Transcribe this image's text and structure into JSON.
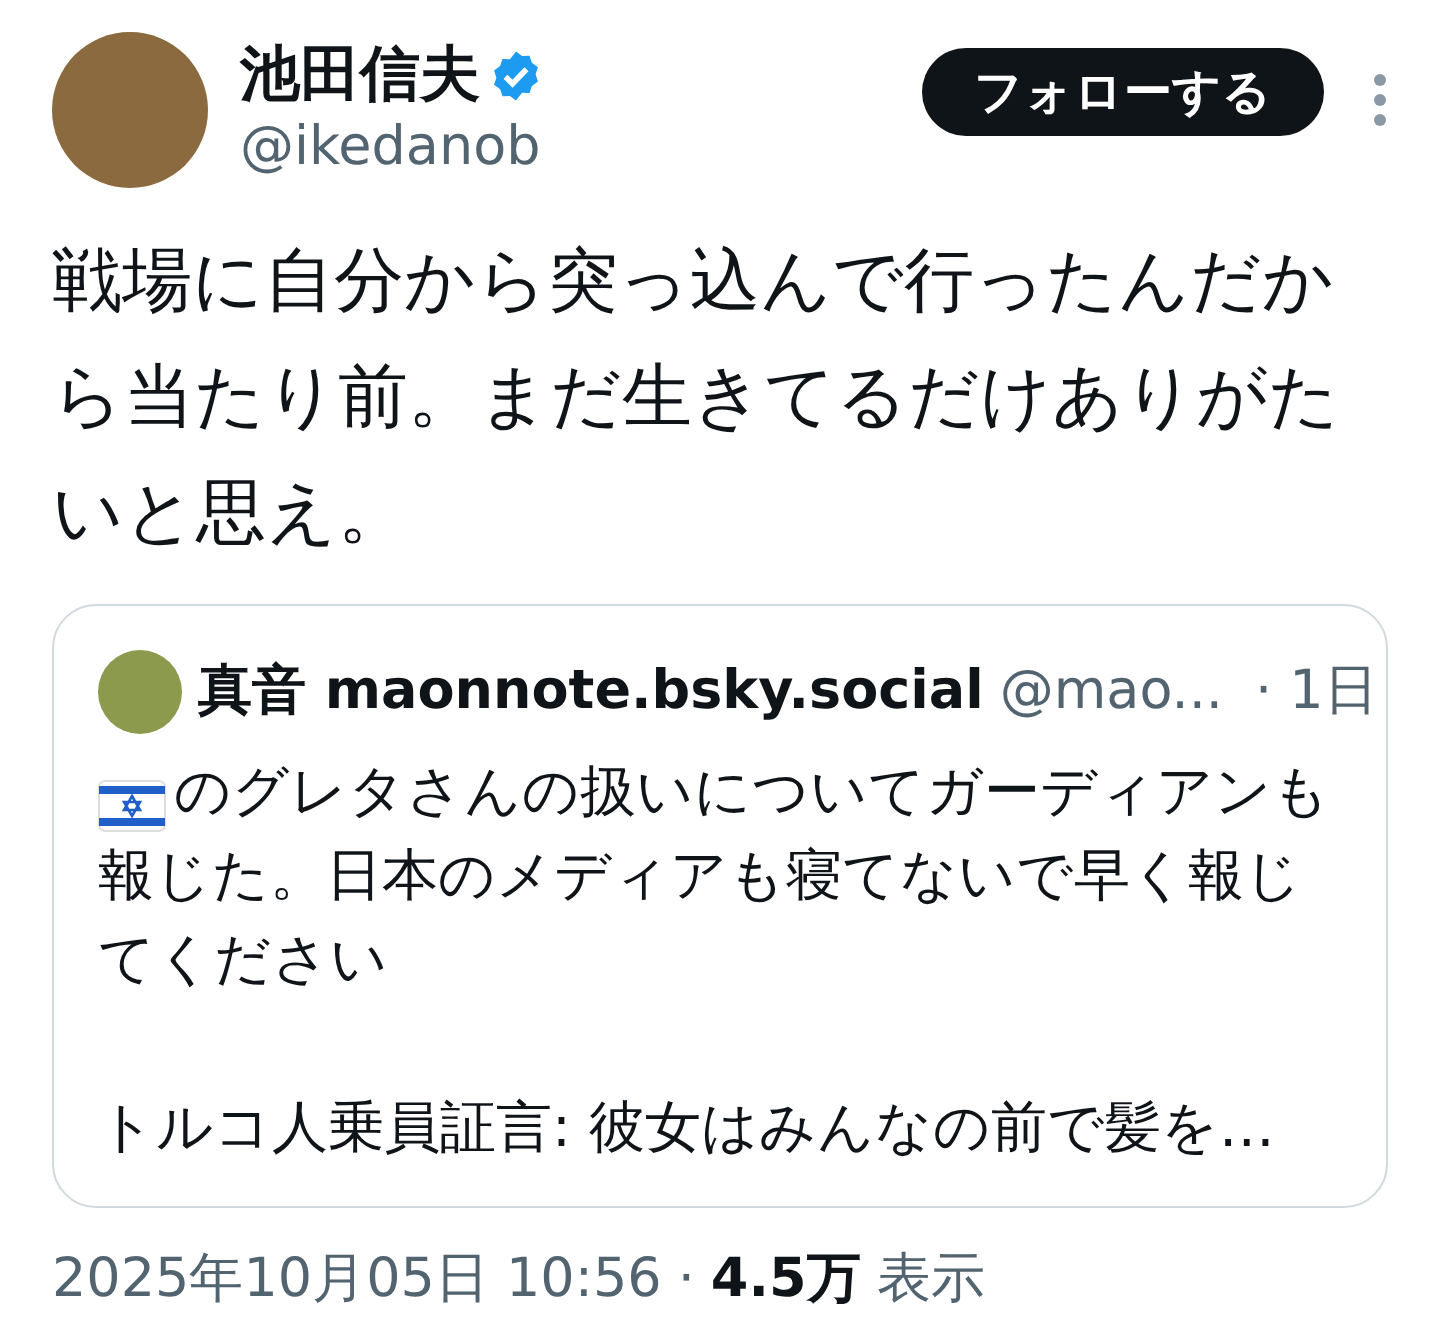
{
  "author": {
    "name": "池田信夫",
    "verified": true,
    "handle": "@ikedanob"
  },
  "follow_button": "フォローする",
  "text": "戦場に自分から突っ込んで行ったんだから当たり前。まだ生きてるだけありがたいと思え。",
  "quote": {
    "name": "真音 maonnote.bsky.social",
    "handle": "@mao...",
    "time": "· 1日",
    "paragraphs": [
      {
        "flag": true,
        "text": "のグレタさんの扱いについてガーディアンも報じた。日本のメディアも寝てないで早く報じてください"
      },
      {
        "flag": false,
        "text": "トルコ人乗員証言: 彼女はみんなの前で髪を…"
      }
    ]
  },
  "footer": {
    "timestamp": "2025年10月05日 10:56",
    "separator": "·",
    "views": "4.5万",
    "views_label": "表示"
  }
}
